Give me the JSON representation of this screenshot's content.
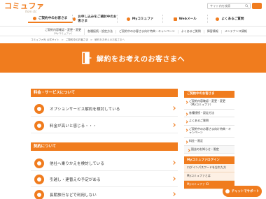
{
  "header": {
    "logo_main": "コミュファ",
    "logo_sub": "from ctc",
    "search_placeholder": "サイト内を検索"
  },
  "topnav": [
    {
      "label": "ご契約中のお客さま"
    },
    {
      "label": "お申し込みをご検討中のお客さま"
    },
    {
      "label": "Myコミュファ"
    },
    {
      "label": "Webメール"
    },
    {
      "label": "よくあるご質問"
    }
  ],
  "subnav": [
    {
      "label": "ご契約内容確認・変更・変更",
      "sub": "（Myコミュファ）"
    },
    {
      "label": "各種接続・設定方法",
      "sub": ""
    },
    {
      "label": "ご契約中のお客さま向け特典・キャンペーン",
      "sub": ""
    },
    {
      "label": "よくあるご質問",
      "sub": ""
    },
    {
      "label": "障害情報",
      "sub": ""
    },
    {
      "label": "メンテナンス情報",
      "sub": ""
    }
  ],
  "breadcrumb": [
    "コミュファ光 公式サイト",
    ">",
    "ご契約中のお客さま",
    ">",
    "解約をお考えのお客さまへ"
  ],
  "hero": {
    "title": "解約をお考えのお客さまへ"
  },
  "sections": [
    {
      "title": "料金・サービスについて",
      "rows": [
        {
          "text": "オプションサービス解約を検討している"
        },
        {
          "text": "料金が高いと感じる・・・"
        }
      ]
    },
    {
      "title": "契約について",
      "rows": [
        {
          "text": "他社へ乗りかえを検討している"
        },
        {
          "text": "引越し・建替えの予定がある"
        },
        {
          "text": "長期旅行などで利用しない"
        }
      ]
    }
  ],
  "sidebar": {
    "head": "ご契約中のお客さま",
    "items": [
      {
        "label": "ご契約内容確認・変更・変更（Myコミュファ）",
        "sub": false
      },
      {
        "label": "各種接続・設定方法",
        "sub": false
      },
      {
        "label": "よくあるご質問",
        "sub": false
      },
      {
        "label": "ご契約中のお客さま向け特典・キャンペーン",
        "sub": false
      },
      {
        "label": "料金・限定",
        "sub": false
      },
      {
        "label": "過去のお知らせ・限定",
        "sub": true
      }
    ],
    "head2": "Myコミュファログイン",
    "items2": [
      {
        "label": "ログインパスワードを忘れた方"
      },
      {
        "label": "Myコミュファとは"
      },
      {
        "label": "Myコミュファ ID"
      }
    ]
  },
  "chat": {
    "label": "チャットでサポート"
  },
  "colors": {
    "accent": "#f07c1e",
    "text": "#333333"
  }
}
